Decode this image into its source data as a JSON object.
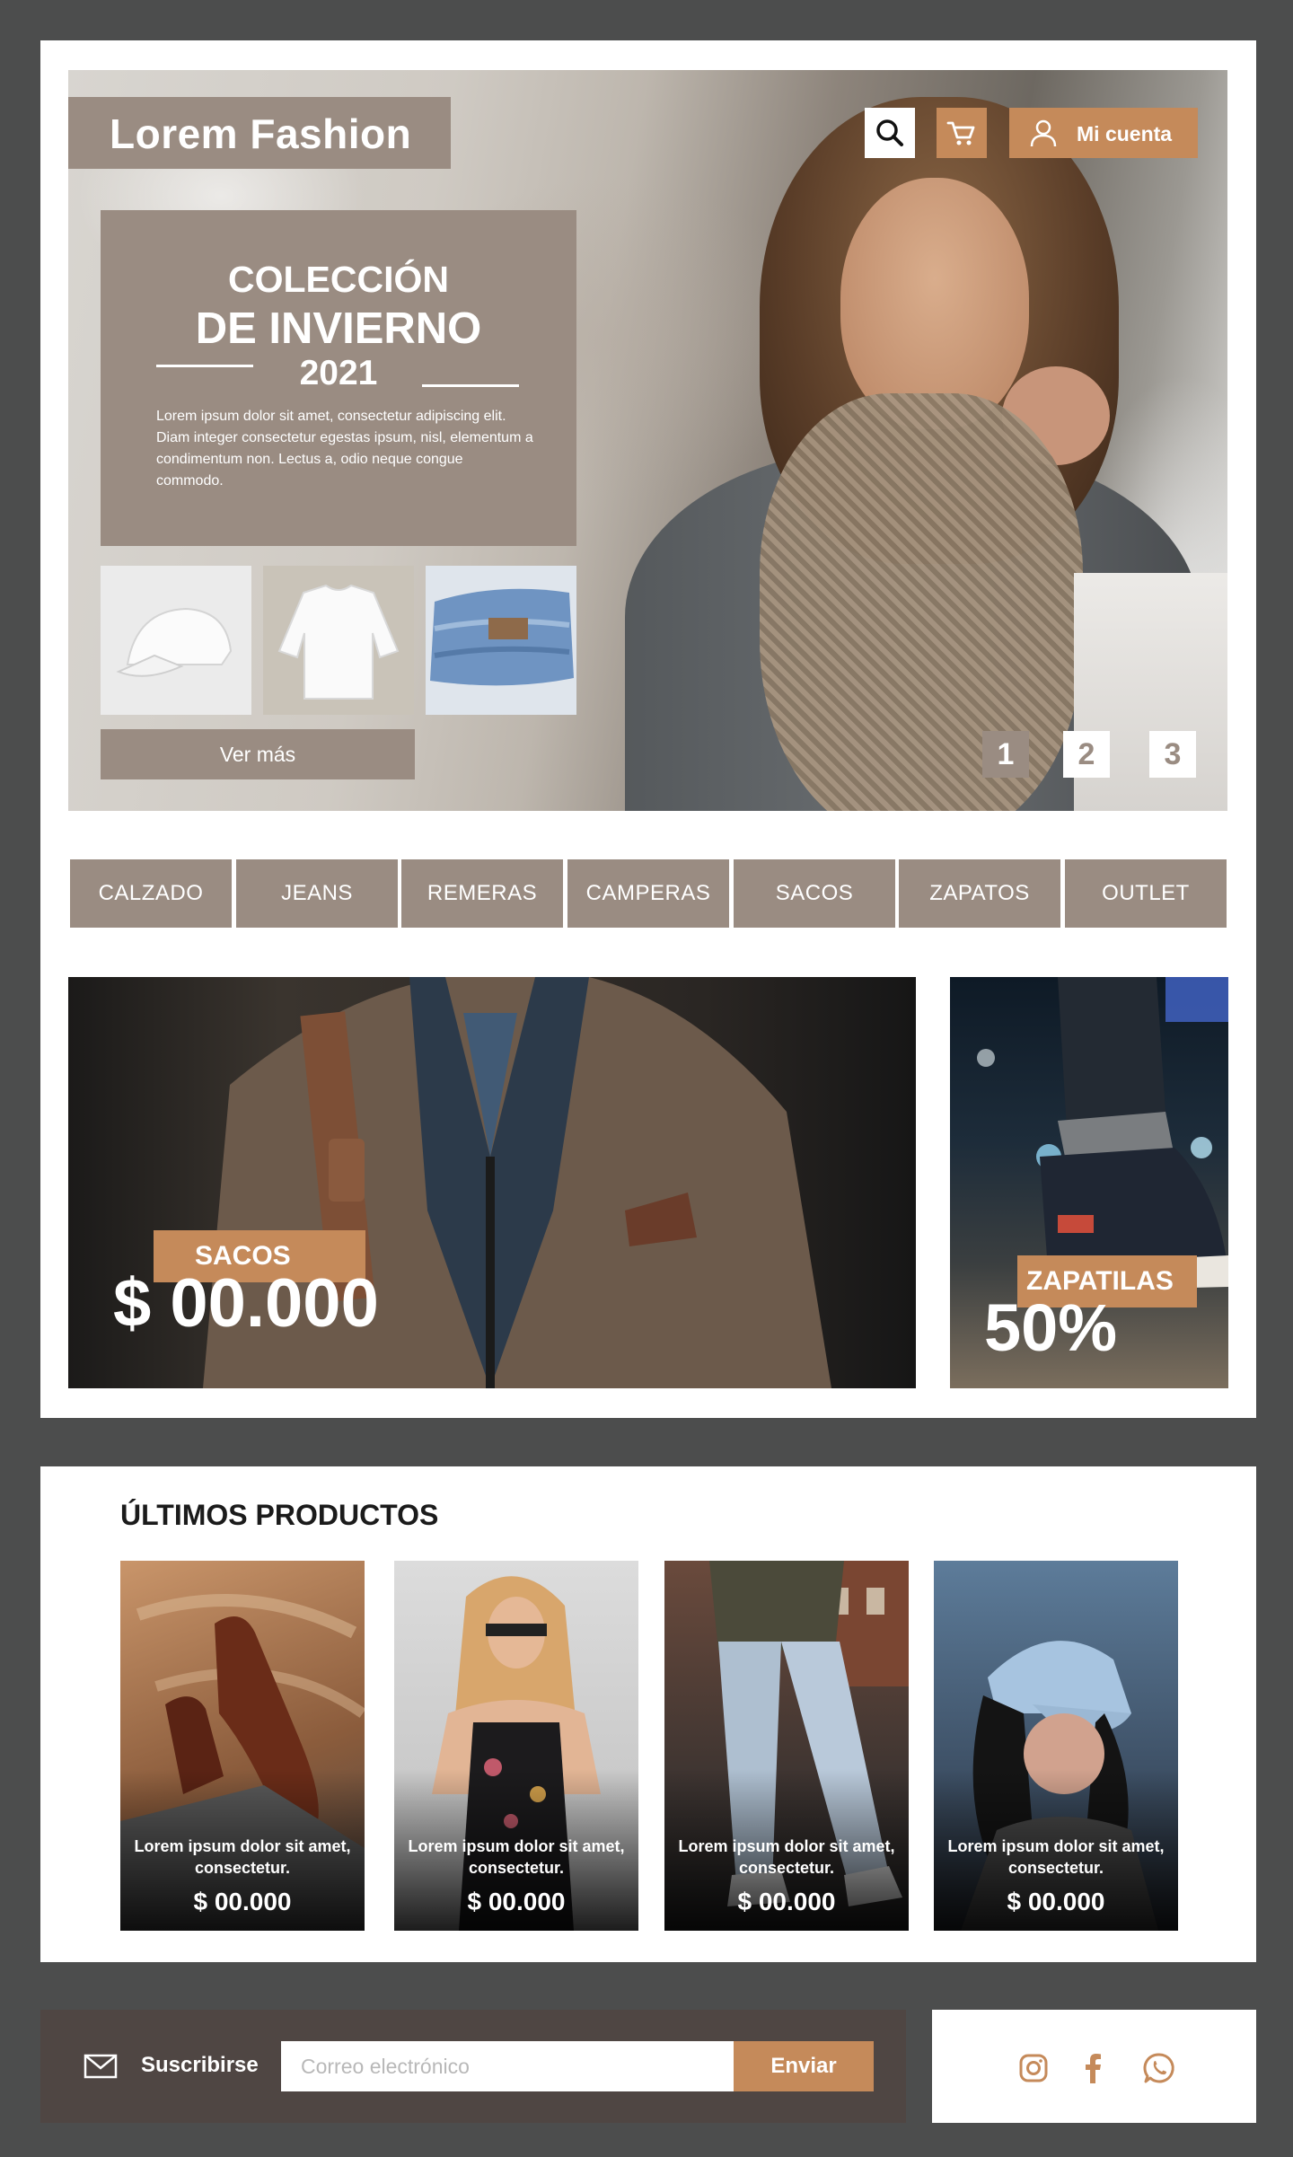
{
  "header": {
    "brand": "Lorem Fashion",
    "account_label": "Mi cuenta"
  },
  "hero": {
    "line1": "COLECCIÓN",
    "line2": "DE INVIERNO",
    "line3": "2021",
    "description": "Lorem ipsum dolor sit amet, consectetur adipiscing elit. Diam integer consectetur egestas ipsum, nisl, elementum a condimentum non. Lectus a, odio neque congue commodo.",
    "cta": "Ver más",
    "pages": [
      "1",
      "2",
      "3"
    ],
    "active_page": "1"
  },
  "categories": [
    "CALZADO",
    "JEANS",
    "REMERAS",
    "CAMPERAS",
    "SACOS",
    "ZAPATOS",
    "OUTLET"
  ],
  "banners": {
    "left": {
      "tag": "SACOS",
      "price": "$ 00.000"
    },
    "right": {
      "tag": "ZAPATILAS",
      "discount": "50%"
    }
  },
  "products": {
    "title": "ÚLTIMOS PRODUCTOS",
    "items": [
      {
        "text": "Lorem ipsum dolor sit amet, consectetur.",
        "price": "$ 00.000"
      },
      {
        "text": "Lorem ipsum dolor sit amet, consectetur.",
        "price": "$ 00.000"
      },
      {
        "text": "Lorem ipsum dolor sit amet, consectetur.",
        "price": "$ 00.000"
      },
      {
        "text": "Lorem ipsum dolor sit amet, consectetur.",
        "price": "$ 00.000"
      }
    ]
  },
  "footer": {
    "subscribe_label": "Suscribirse",
    "email_placeholder": "Correo electrónico",
    "send_label": "Enviar",
    "social": [
      "instagram-icon",
      "facebook-icon",
      "whatsapp-icon"
    ]
  },
  "colors": {
    "taupe": "#9a8c82",
    "accent": "#c58a5a",
    "footer_dark": "#4f4643",
    "page_bg": "#4c4d4d"
  }
}
